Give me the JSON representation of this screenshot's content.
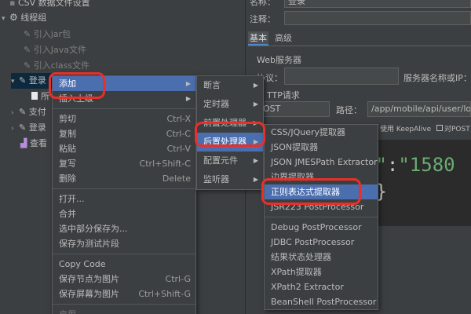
{
  "tree": {
    "csv_item": "CSV 数据文件设置",
    "thread_group": "线程组",
    "items": [
      "引入jar包",
      "引入Java文件",
      "引入class文件"
    ],
    "selected_stub": "登录",
    "row_after": "所",
    "row_zhi": "支付",
    "row_login2": "登录",
    "row_view": "查看"
  },
  "context_menu": {
    "items": [
      {
        "label": "添加",
        "submenu": true,
        "selected": true
      },
      {
        "label": "插入上级",
        "submenu": true
      },
      {
        "sep": true
      },
      {
        "label": "剪切",
        "shortcut": "Ctrl-X"
      },
      {
        "label": "复制",
        "shortcut": "Ctrl-C"
      },
      {
        "label": "粘贴",
        "shortcut": "Ctrl-V"
      },
      {
        "label": "复写",
        "shortcut": "Ctrl+Shift-C"
      },
      {
        "label": "删除",
        "shortcut": "Delete"
      },
      {
        "sep": true
      },
      {
        "label": "打开..."
      },
      {
        "label": "合并"
      },
      {
        "label": "选中部分保存为..."
      },
      {
        "label": "保存为测试片段"
      },
      {
        "sep": true
      },
      {
        "label": "Copy Code"
      },
      {
        "label": "保存节点为图片",
        "shortcut": "Ctrl-G"
      },
      {
        "label": "保存屏幕为图片",
        "shortcut": "Ctrl+Shift-G"
      },
      {
        "sep": true
      },
      {
        "label": "启用",
        "disabled": true
      }
    ]
  },
  "add_menu": {
    "items": [
      {
        "label": "断言",
        "submenu": true
      },
      {
        "label": "定时器",
        "submenu": true
      },
      {
        "label": "前置处理器",
        "submenu": true
      },
      {
        "label": "后置处理器",
        "submenu": true,
        "selected": true
      },
      {
        "label": "配置元件",
        "submenu": true
      },
      {
        "label": "监听器",
        "submenu": true
      }
    ]
  },
  "post_menu": {
    "items": [
      {
        "label": "CSS/JQuery提取器"
      },
      {
        "label": "JSON提取器"
      },
      {
        "label": "JSON JMESPath Extractor"
      },
      {
        "label": "边界提取器"
      },
      {
        "label": "正则表达式提取器",
        "selected": true
      },
      {
        "label": "JSR223 PostProcessor"
      },
      {
        "sep": true
      },
      {
        "label": "Debug PostProcessor"
      },
      {
        "label": "JDBC PostProcessor"
      },
      {
        "label": "结果状态处理器"
      },
      {
        "label": "XPath提取器"
      },
      {
        "label": "XPath2 Extractor"
      },
      {
        "label": "BeanShell PostProcessor"
      }
    ]
  },
  "right": {
    "name_label": "名称：",
    "name_value": "登录",
    "comment_label": "注释：",
    "tab_basic": "基本",
    "tab_advanced": "高级",
    "web_server": "Web服务器",
    "protocol_label": "协议：",
    "server_label": "服务器名称或IP：",
    "http_request": "TTP请求",
    "method_value": "OST",
    "path_label": "路径：",
    "path_value": "/app/mobile/api/user/logi",
    "keepalive": "使用 KeepAlive",
    "post_label": "对POST",
    "json_line1_key": "e\"",
    "json_line1_colon": ":",
    "json_line1_val": "\"1580",
    "json_line2": "\"}"
  },
  "colors": {
    "accent": "#4b6eaf",
    "highlight": "#e8302a"
  }
}
